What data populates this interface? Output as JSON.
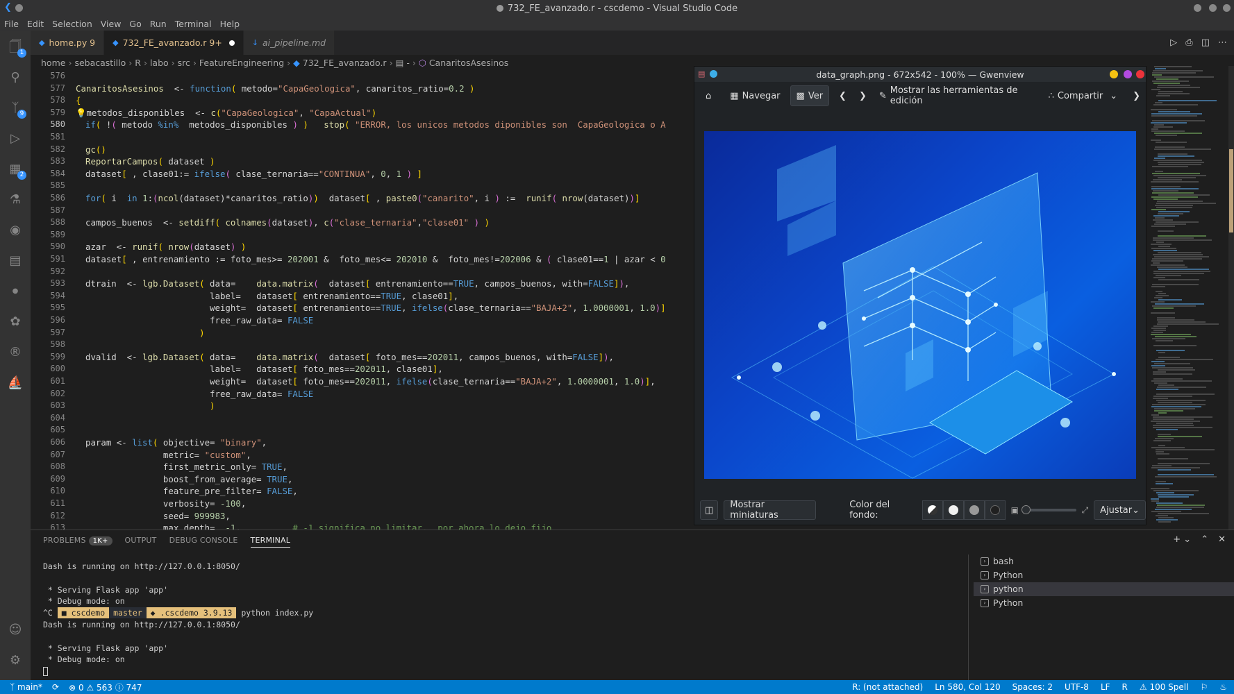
{
  "window": {
    "title": "732_FE_avanzado.r - cscdemo - Visual Studio Code"
  },
  "menu": [
    "File",
    "Edit",
    "Selection",
    "View",
    "Go",
    "Run",
    "Terminal",
    "Help"
  ],
  "activity": {
    "explorer_badge": "1",
    "scm_badge": "9",
    "extensions_badge": "2"
  },
  "tabs": [
    {
      "label": "home.py 9",
      "active": false
    },
    {
      "label": "732_FE_avanzado.r 9+",
      "active": true
    },
    {
      "label": "ai_pipeline.md",
      "active": false
    }
  ],
  "breadcrumb": [
    "home",
    "sebacastillo",
    "R",
    "labo",
    "src",
    "FeatureEngineering",
    "732_FE_avanzado.r",
    "-",
    "CanaritosAsesinos"
  ],
  "editor": {
    "line_numbers": [
      "576",
      "577",
      "578",
      "579",
      "580",
      "581",
      "582",
      "583",
      "584",
      "585",
      "586",
      "587",
      "588",
      "589",
      "590",
      "591",
      "592",
      "593",
      "594",
      "595",
      "596",
      "597",
      "598",
      "599",
      "600",
      "601",
      "602",
      "603",
      "604",
      "605",
      "606",
      "607",
      "608",
      "609",
      "610",
      "611",
      "612",
      "613"
    ],
    "current_line": "580"
  },
  "gwenview": {
    "title": "data_graph.png - 672x542 - 100% — Gwenview",
    "toolbar": {
      "navigate": "Navegar",
      "view": "Ver",
      "edit_tools": "Mostrar las herramientas de edición",
      "share": "Compartir"
    },
    "bottom": {
      "thumbnails": "Mostrar miniaturas",
      "bg_color_label": "Color del fondo:",
      "zoom_value": "Ajustar"
    }
  },
  "panel": {
    "tabs": {
      "problems": "PROBLEMS",
      "problems_badge": "1K+",
      "output": "OUTPUT",
      "debug": "DEBUG CONSOLE",
      "terminal": "TERMINAL"
    },
    "terminal_lines": [
      "Dash is running on http://127.0.0.1:8050/",
      "",
      " * Serving Flask app 'app'",
      " * Debug mode: on"
    ],
    "prompt": {
      "prefix": "^C",
      "dir": "cscdemo",
      "branch": "master",
      "env": ".cscdemo 3.9.13",
      "command": "python index.py"
    },
    "terminal_lines_2": [
      "Dash is running on http://127.0.0.1:8050/",
      "",
      " * Serving Flask app 'app'",
      " * Debug mode: on"
    ],
    "terminals": [
      "bash",
      "Python",
      "python",
      "Python"
    ]
  },
  "statusbar": {
    "branch": "main*",
    "errors": "0",
    "warnings": "563",
    "info": "747",
    "r_status": "R: (not attached)",
    "position": "Ln 580, Col 120",
    "spaces": "Spaces: 2",
    "encoding": "UTF-8",
    "eol": "LF",
    "language": "R",
    "spell": "100 Spell"
  }
}
